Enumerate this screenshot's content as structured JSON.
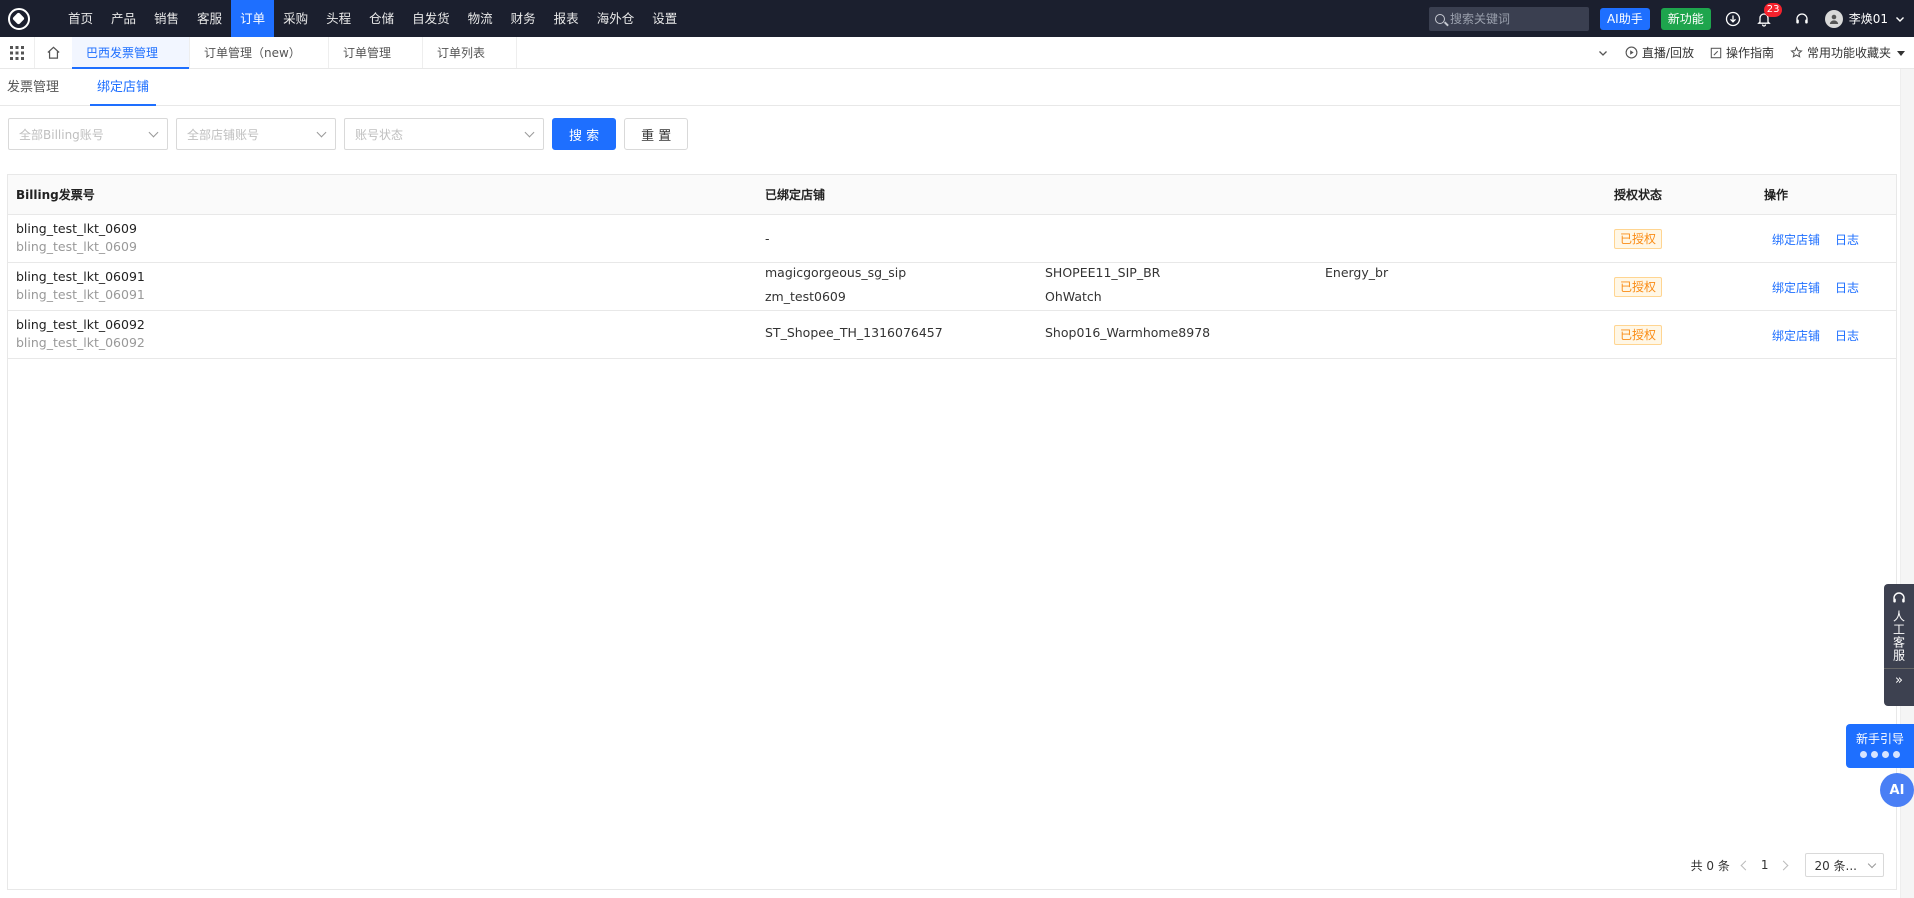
{
  "nav": {
    "menu": [
      {
        "label": "首页",
        "active": false
      },
      {
        "label": "产品",
        "active": false
      },
      {
        "label": "销售",
        "active": false
      },
      {
        "label": "客服",
        "active": false
      },
      {
        "label": "订单",
        "active": true
      },
      {
        "label": "采购",
        "active": false
      },
      {
        "label": "头程",
        "active": false
      },
      {
        "label": "仓储",
        "active": false
      },
      {
        "label": "自发货",
        "active": false
      },
      {
        "label": "物流",
        "active": false
      },
      {
        "label": "财务",
        "active": false
      },
      {
        "label": "报表",
        "active": false
      },
      {
        "label": "海外仓",
        "active": false
      },
      {
        "label": "设置",
        "active": false
      }
    ],
    "search_placeholder": "搜索关键词",
    "ai_label": "AI助手",
    "new_label": "新功能",
    "notification_count": "23",
    "username": "李焕01"
  },
  "tabs": {
    "items": [
      {
        "label": "巴西发票管理",
        "active": true
      },
      {
        "label": "订单管理（new）",
        "active": false
      },
      {
        "label": "订单管理",
        "active": false
      },
      {
        "label": "订单列表",
        "active": false
      }
    ],
    "live_label": "直播/回放",
    "guide_label": "操作指南",
    "favorites_label": "常用功能收藏夹"
  },
  "subtabs": {
    "invoice": "发票管理",
    "bind": "绑定店铺"
  },
  "filters": {
    "billing_placeholder": "全部Billing账号",
    "store_placeholder": "全部店铺账号",
    "status_placeholder": "账号状态",
    "search_label": "搜 索",
    "reset_label": "重 置"
  },
  "table": {
    "headers": {
      "billing": "Billing发票号",
      "stores": "已绑定店铺",
      "status": "授权状态",
      "ops": "操作"
    },
    "rows": [
      {
        "billing": "bling_test_lkt_0609",
        "billing_sub": "bling_test_lkt_0609",
        "stores": [
          "-"
        ],
        "status": "已授权",
        "op_bind": "绑定店铺",
        "op_log": "日志"
      },
      {
        "billing": "bling_test_lkt_06091",
        "billing_sub": "bling_test_lkt_06091",
        "stores": [
          "magicgorgeous_sg_sip",
          "SHOPEE11_SIP_BR",
          "Energy_br",
          "zm_test0609",
          "OhWatch"
        ],
        "status": "已授权",
        "op_bind": "绑定店铺",
        "op_log": "日志"
      },
      {
        "billing": "bling_test_lkt_06092",
        "billing_sub": "bling_test_lkt_06092",
        "stores": [
          "ST_Shopee_TH_1316076457",
          "Shop016_Warmhome8978"
        ],
        "status": "已授权",
        "op_bind": "绑定店铺",
        "op_log": "日志"
      }
    ]
  },
  "pager": {
    "total": "共 0 条",
    "page": "1",
    "size": "20 条..."
  },
  "float": {
    "service": "人工客服",
    "guide": "新手引导",
    "ai": "AI"
  },
  "colors": {
    "nav_bg": "#1b1f2e",
    "accent": "#1e6fff",
    "new_green": "#1ea54d",
    "status_orange": "#fa8c16"
  }
}
